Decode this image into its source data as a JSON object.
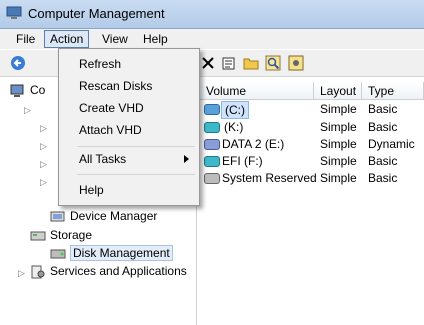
{
  "window": {
    "title": "Computer Management"
  },
  "menubar": {
    "items": [
      "File",
      "Action",
      "View",
      "Help"
    ],
    "active": "Action"
  },
  "action_menu": {
    "items": [
      "Refresh",
      "Rescan Disks",
      "Create VHD",
      "Attach VHD",
      "All Tasks",
      "Help"
    ]
  },
  "tree": {
    "root_label_partial": "Co",
    "items": [
      "Device Manager",
      "Storage",
      "Disk Management",
      "Services and Applications"
    ],
    "selected": "Disk Management"
  },
  "volume_list": {
    "columns": [
      "Volume",
      "Layout",
      "Type"
    ],
    "rows": [
      {
        "volume": "(C:)",
        "layout": "Simple",
        "type": "Basic"
      },
      {
        "volume": "(K:)",
        "layout": "Simple",
        "type": "Basic"
      },
      {
        "volume": "DATA 2 (E:)",
        "layout": "Simple",
        "type": "Dynamic"
      },
      {
        "volume": "EFI (F:)",
        "layout": "Simple",
        "type": "Basic"
      },
      {
        "volume": "System Reserved",
        "layout": "Simple",
        "type": "Basic"
      }
    ]
  },
  "colors": {
    "titlebar": "#c9dcf2",
    "menu_bg": "#f1f1f1",
    "selection": "#e3edf9",
    "dynamic_volume": "#8a9dd6",
    "efi_volume": "#3fb8c9",
    "basic_volume": "#5aa0d8"
  },
  "icons": [
    "app-icon",
    "back-arrow-icon",
    "delete-icon",
    "properties-icon",
    "open-folder-icon",
    "magnifier-icon",
    "settings-icon",
    "computer-icon",
    "disk-icon",
    "services-icon",
    "device-manager-icon",
    "storage-icon",
    "submenu-arrow-icon"
  ]
}
